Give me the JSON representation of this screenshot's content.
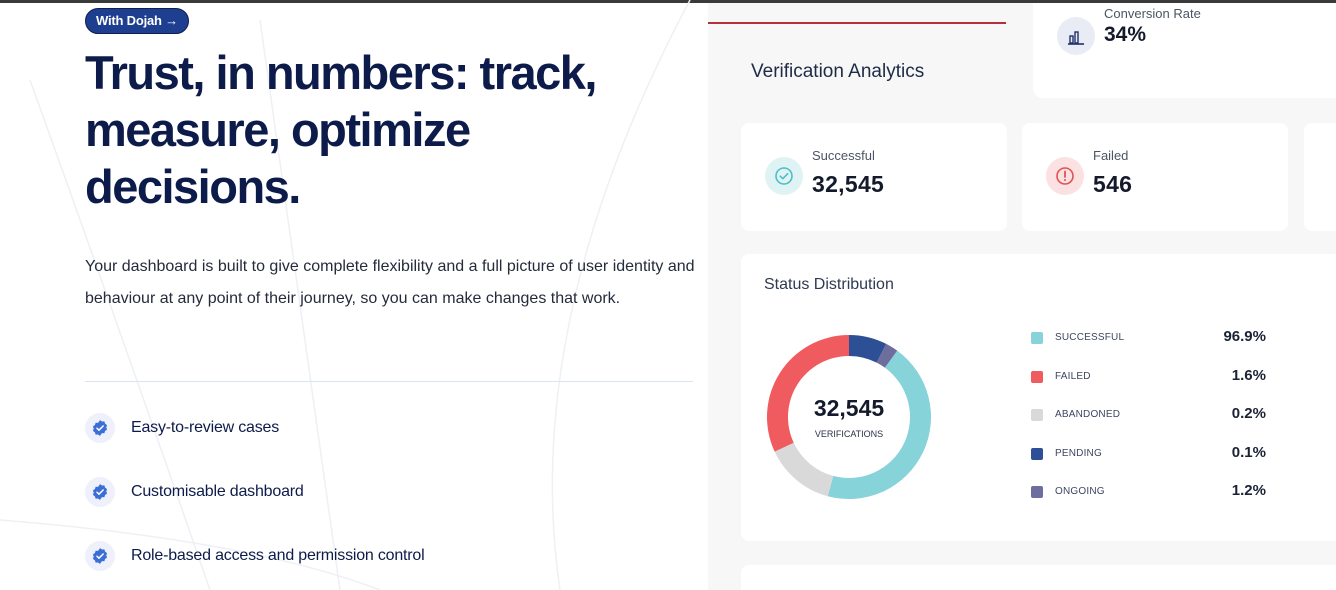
{
  "hero": {
    "badge": "With Dojah →",
    "headline": "Trust, in numbers: track, measure, optimize decisions.",
    "description": "Your dashboard is built to give complete flexibility and a full picture of user identity and behaviour at any point of their journey, so you can make changes that work.",
    "features": [
      {
        "label": "Easy-to-review cases",
        "icon": "verified-check-icon"
      },
      {
        "label": "Customisable dashboard",
        "icon": "verified-check-icon"
      },
      {
        "label": "Role-based access and permission control",
        "icon": "verified-check-icon"
      }
    ]
  },
  "dashboard": {
    "title": "Verification Analytics",
    "conversion": {
      "label": "Conversion Rate",
      "value": "34%",
      "icon": "bar-chart-icon"
    },
    "stats": [
      {
        "label": "Successful",
        "value": "32,545",
        "icon": "check-circle-icon",
        "color": "#5cc7cc"
      },
      {
        "label": "Failed",
        "value": "546",
        "icon": "alert-circle-icon",
        "color": "#e05a5a"
      }
    ],
    "distribution": {
      "title": "Status Distribution",
      "center_value": "32,545",
      "center_label": "VERIFICATIONS"
    }
  },
  "chart_data": {
    "type": "pie",
    "title": "Status Distribution",
    "categories": [
      "SUCCESSFUL",
      "FAILED",
      "ABANDONED",
      "PENDING",
      "ONGOING"
    ],
    "labels": [
      "96.9%",
      "1.6%",
      "0.2%",
      "0.1%",
      "1.2%"
    ],
    "values": [
      96.9,
      1.6,
      0.2,
      0.1,
      1.2
    ],
    "colors": [
      "#86d3d9",
      "#ef5b5e",
      "#d9d9d9",
      "#2c4f95",
      "#6e6e9e"
    ],
    "legend_placement": "right"
  }
}
